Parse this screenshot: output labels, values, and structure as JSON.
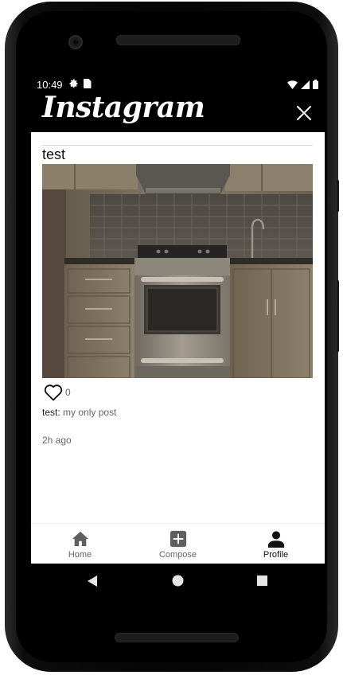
{
  "status_bar": {
    "time": "10:49",
    "left_icons": [
      "gear-icon",
      "sim-card-icon"
    ],
    "right_icons": [
      "wifi-icon",
      "cell-signal-icon",
      "battery-icon"
    ]
  },
  "app_bar": {
    "title": "Instagram",
    "close_icon": "close-icon"
  },
  "post": {
    "username": "test",
    "image_description_icon": "kitchen-stove-photo",
    "like_count": "0",
    "caption_username": "test:",
    "caption_text": "my only post",
    "timestamp": "2h ago"
  },
  "bottom_nav": {
    "items": [
      {
        "label": "Home",
        "icon": "home-icon",
        "active": false
      },
      {
        "label": "Compose",
        "icon": "compose-icon",
        "active": false
      },
      {
        "label": "Profile",
        "icon": "profile-icon",
        "active": true
      }
    ]
  },
  "system_nav": {
    "buttons": [
      "back-icon",
      "home-circle-icon",
      "recents-icon"
    ]
  },
  "colors": {
    "app_bar": "#000000",
    "screen_bg": "#ffffff",
    "secondary_text": "#666666",
    "primary_text": "#111111"
  }
}
